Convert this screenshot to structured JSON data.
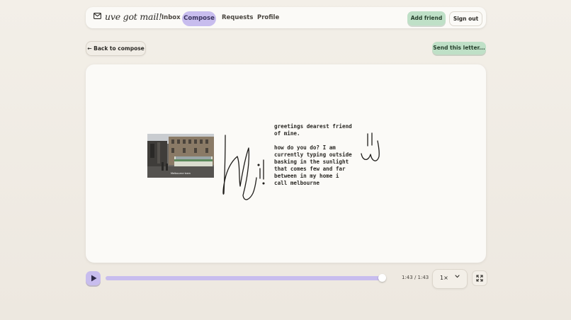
{
  "nav": {
    "brand": "uve got mail!",
    "links": [
      "Inbox",
      "Compose",
      "Requests",
      "Profile"
    ],
    "active_link": "Compose",
    "add_friend": "Add friend",
    "sign_out": "Sign out"
  },
  "actions": {
    "back": "← Back to compose",
    "send": "Send this letter..."
  },
  "letter": {
    "paragraph1": "greetings dearest friend of mine.",
    "paragraph2": "how do you do? I am currently typing outside basking in the sunlight that comes few and far between in my home i call melbourne",
    "photo_caption": "Melbourne tram"
  },
  "player": {
    "time": "1:43 / 1:43",
    "progress": 1.0,
    "speed": "1×"
  },
  "colors": {
    "accent_purple": "#c8bdee",
    "accent_green": "#bfe0c7",
    "background": "#efeae2"
  },
  "icons": {
    "brand": "envelope-icon",
    "play": "play-icon",
    "speed": "chevron-down-icon",
    "fullscreen": "fullscreen-icon"
  }
}
